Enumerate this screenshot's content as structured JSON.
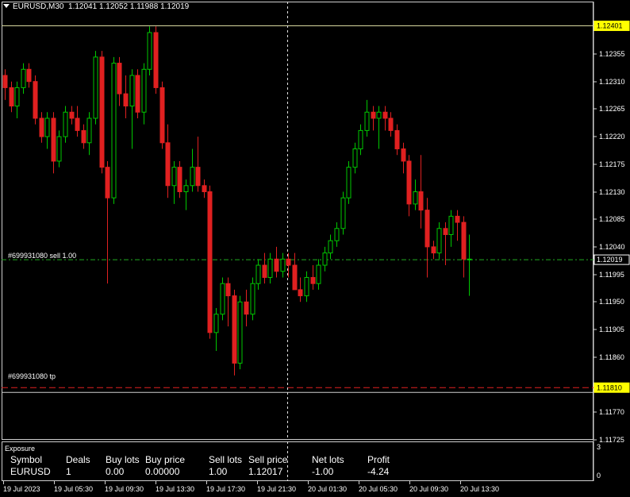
{
  "header": {
    "symbol_tf": "EURUSD,M30",
    "ohlc": "1.12041 1.12052 1.11988 1.12019"
  },
  "price_axis": {
    "ticks": [
      "1.12355",
      "1.12310",
      "1.12265",
      "1.12220",
      "1.12175",
      "1.12130",
      "1.12085",
      "1.12040",
      "1.11995",
      "1.11950",
      "1.11905",
      "1.11860",
      "1.11770",
      "1.11725"
    ],
    "badges": {
      "top": "1.12401",
      "current": "1.12019",
      "tp": "1.11810"
    }
  },
  "time_axis": [
    "19 Jul 2023",
    "19 Jul 05:30",
    "19 Jul 09:30",
    "19 Jul 13:30",
    "19 Jul 17:30",
    "19 Jul 21:30",
    "20 Jul 01:30",
    "20 Jul 05:30",
    "20 Jul 09:30",
    "20 Jul 13:30"
  ],
  "order_labels": {
    "sell": "#699931080 sell 1.00",
    "tp": "#699931080 tp"
  },
  "exposure": {
    "title": "Exposure",
    "headers": [
      "Symbol",
      "Deals",
      "Buy lots",
      "Buy price",
      "Sell lots",
      "Sell price",
      "Net lots",
      "Profit"
    ],
    "row": [
      "EURUSD",
      "1",
      "0.00",
      "0.00000",
      "1.00",
      "1.12017",
      "-1.00",
      "-4.24"
    ],
    "scale_top": "3",
    "scale_bottom": "0"
  },
  "colors": {
    "up": "#00c800",
    "down": "#e02020",
    "sell_line": "#22aa22",
    "tp_line": "#e02020",
    "top_line": "#d8d8a0"
  },
  "chart_data": {
    "type": "candlestick",
    "symbol": "EURUSD",
    "timeframe": "M30",
    "candles": [
      [
        1.1232,
        1.1233,
        1.1228,
        1.123
      ],
      [
        1.123,
        1.1231,
        1.1226,
        1.1227
      ],
      [
        1.1227,
        1.1231,
        1.1225,
        1.123
      ],
      [
        1.123,
        1.1234,
        1.1229,
        1.1233
      ],
      [
        1.1233,
        1.1234,
        1.123,
        1.1231
      ],
      [
        1.1231,
        1.1232,
        1.1224,
        1.1225
      ],
      [
        1.1225,
        1.1226,
        1.1221,
        1.1222
      ],
      [
        1.1222,
        1.1226,
        1.122,
        1.1225
      ],
      [
        1.1225,
        1.1226,
        1.1216,
        1.1218
      ],
      [
        1.1218,
        1.1223,
        1.1217,
        1.1222
      ],
      [
        1.1222,
        1.1227,
        1.1221,
        1.1226
      ],
      [
        1.1226,
        1.1227,
        1.1224,
        1.1225
      ],
      [
        1.1225,
        1.1227,
        1.1222,
        1.1223
      ],
      [
        1.1223,
        1.1224,
        1.122,
        1.1221
      ],
      [
        1.1221,
        1.1226,
        1.1219,
        1.1225
      ],
      [
        1.1225,
        1.1236,
        1.1224,
        1.1235
      ],
      [
        1.1235,
        1.1236,
        1.1216,
        1.1217
      ],
      [
        1.1217,
        1.1218,
        1.1198,
        1.1212
      ],
      [
        1.1212,
        1.1235,
        1.1211,
        1.1234
      ],
      [
        1.1234,
        1.1235,
        1.1227,
        1.1229
      ],
      [
        1.1229,
        1.1232,
        1.1225,
        1.1227
      ],
      [
        1.1227,
        1.1233,
        1.122,
        1.1232
      ],
      [
        1.1232,
        1.1233,
        1.1225,
        1.1226
      ],
      [
        1.1226,
        1.1234,
        1.1224,
        1.1233
      ],
      [
        1.1233,
        1.124,
        1.1232,
        1.1239
      ],
      [
        1.1239,
        1.124,
        1.1229,
        1.123
      ],
      [
        1.123,
        1.1231,
        1.122,
        1.1221
      ],
      [
        1.1221,
        1.1224,
        1.1212,
        1.1214
      ],
      [
        1.1214,
        1.1218,
        1.1211,
        1.1217
      ],
      [
        1.1217,
        1.1218,
        1.1212,
        1.1213
      ],
      [
        1.1213,
        1.1215,
        1.121,
        1.1214
      ],
      [
        1.1214,
        1.122,
        1.1213,
        1.1217
      ],
      [
        1.1217,
        1.1222,
        1.1213,
        1.1214
      ],
      [
        1.1214,
        1.1215,
        1.1212,
        1.1213
      ],
      [
        1.1213,
        1.1214,
        1.1189,
        1.119
      ],
      [
        1.119,
        1.1194,
        1.1187,
        1.1193
      ],
      [
        1.1193,
        1.1199,
        1.1192,
        1.1198
      ],
      [
        1.1198,
        1.1199,
        1.1191,
        1.1196
      ],
      [
        1.1196,
        1.1197,
        1.1183,
        1.1185
      ],
      [
        1.1185,
        1.1196,
        1.1184,
        1.1195
      ],
      [
        1.1195,
        1.1197,
        1.1191,
        1.1193
      ],
      [
        1.1193,
        1.1199,
        1.1192,
        1.1198
      ],
      [
        1.1198,
        1.1202,
        1.1197,
        1.1201
      ],
      [
        1.1201,
        1.1203,
        1.1198,
        1.1199
      ],
      [
        1.1199,
        1.1203,
        1.1198,
        1.1202
      ],
      [
        1.1202,
        1.1204,
        1.1199,
        1.12
      ],
      [
        1.12,
        1.1203,
        1.1199,
        1.1202
      ],
      [
        1.1202,
        1.1203,
        1.1199,
        1.1201
      ],
      [
        1.1201,
        1.1203,
        1.1198,
        1.1197
      ],
      [
        1.1197,
        1.1199,
        1.1195,
        1.1196
      ],
      [
        1.1196,
        1.12,
        1.1195,
        1.1199
      ],
      [
        1.1199,
        1.1201,
        1.1197,
        1.1198
      ],
      [
        1.1198,
        1.1202,
        1.1197,
        1.1201
      ],
      [
        1.1201,
        1.1204,
        1.12,
        1.1203
      ],
      [
        1.1203,
        1.1206,
        1.1202,
        1.1205
      ],
      [
        1.1205,
        1.1208,
        1.1204,
        1.1207
      ],
      [
        1.1207,
        1.1213,
        1.1206,
        1.1212
      ],
      [
        1.1212,
        1.1218,
        1.1211,
        1.1217
      ],
      [
        1.1217,
        1.1221,
        1.1216,
        1.122
      ],
      [
        1.122,
        1.1224,
        1.1219,
        1.1223
      ],
      [
        1.1223,
        1.1228,
        1.1222,
        1.1226
      ],
      [
        1.1226,
        1.1227,
        1.1223,
        1.1225
      ],
      [
        1.1225,
        1.1227,
        1.122,
        1.1226
      ],
      [
        1.1226,
        1.1227,
        1.1223,
        1.1225
      ],
      [
        1.1225,
        1.1226,
        1.1222,
        1.1223
      ],
      [
        1.1223,
        1.1224,
        1.1219,
        1.122
      ],
      [
        1.122,
        1.1221,
        1.1216,
        1.1218
      ],
      [
        1.1218,
        1.1219,
        1.1209,
        1.1211
      ],
      [
        1.1211,
        1.1215,
        1.121,
        1.1213
      ],
      [
        1.1213,
        1.1219,
        1.1207,
        1.121
      ],
      [
        1.121,
        1.1212,
        1.1199,
        1.1204
      ],
      [
        1.1204,
        1.1205,
        1.1202,
        1.1203
      ],
      [
        1.1203,
        1.1208,
        1.1202,
        1.1207
      ],
      [
        1.1207,
        1.1208,
        1.1201,
        1.1206
      ],
      [
        1.1206,
        1.121,
        1.1204,
        1.1209
      ],
      [
        1.1209,
        1.121,
        1.1205,
        1.1208
      ],
      [
        1.1208,
        1.1209,
        1.1199,
        1.1202
      ],
      [
        1.1202,
        1.1206,
        1.1196,
        1.1202
      ]
    ]
  }
}
